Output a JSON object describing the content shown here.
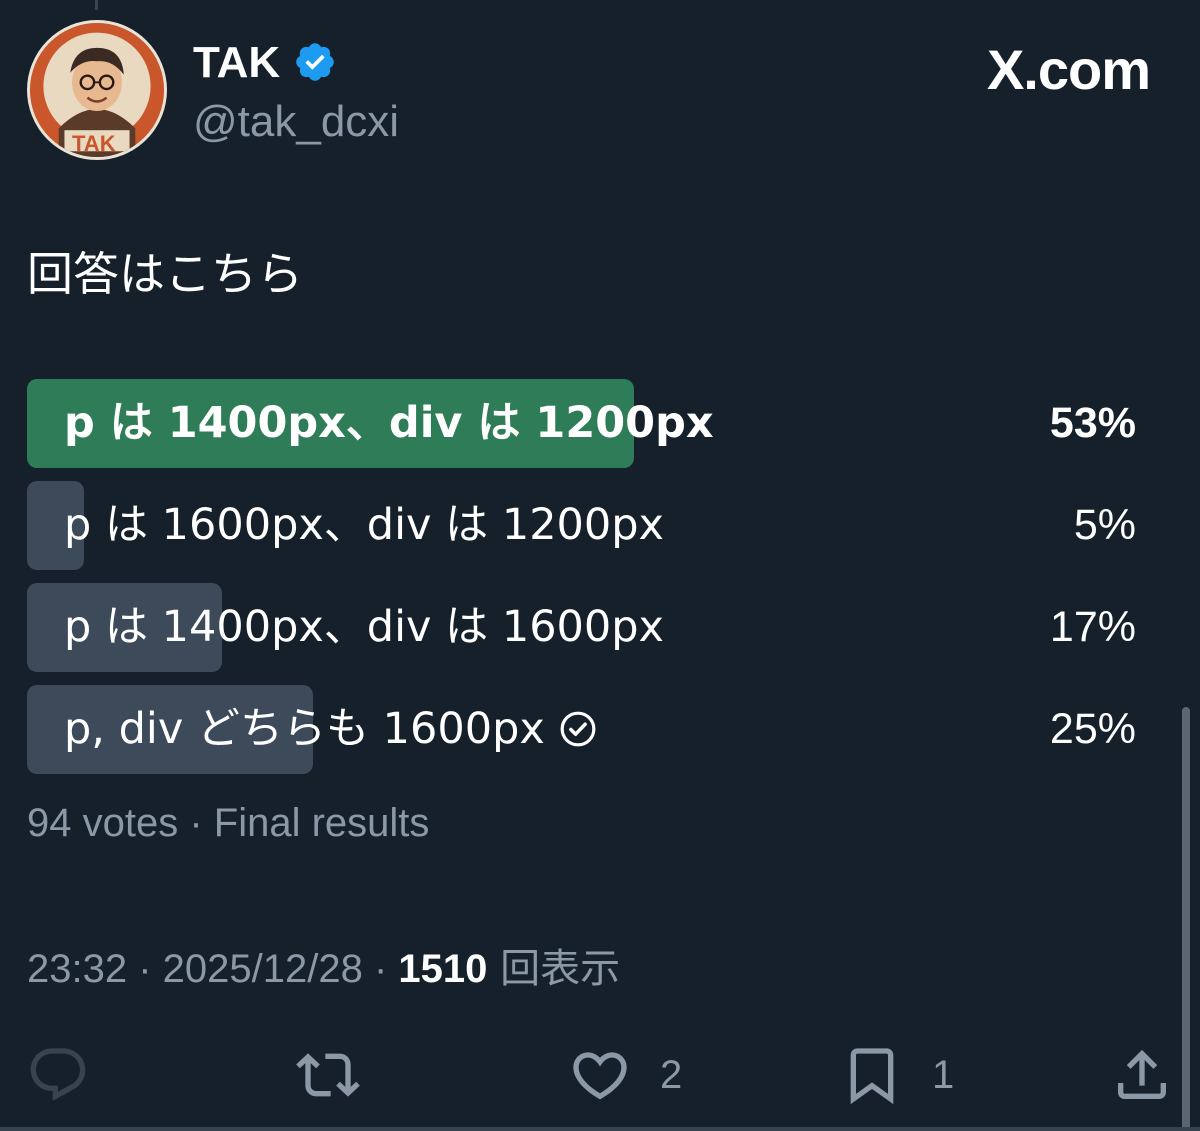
{
  "author": {
    "name": "TAK",
    "handle": "@tak_dcxi",
    "avatar_text": "TAK",
    "verified": true
  },
  "brand": "X.com",
  "tweet": {
    "text": "回答はこちら"
  },
  "poll": {
    "options": [
      {
        "label": "p は 1400px、div は 1200px",
        "percent_text": "53%",
        "percent": 53,
        "winner": true,
        "selected": false
      },
      {
        "label": "p は 1600px、div は 1200px",
        "percent_text": "5%",
        "percent": 5,
        "winner": false,
        "selected": false
      },
      {
        "label": "p は 1400px、div は 1600px",
        "percent_text": "17%",
        "percent": 17,
        "winner": false,
        "selected": false
      },
      {
        "label": "p, div どちらも 1600px",
        "percent_text": "25%",
        "percent": 25,
        "winner": false,
        "selected": true
      }
    ],
    "meta": "94 votes · Final results"
  },
  "timestamp": {
    "time_date": "23:32 · 2025/12/28 · ",
    "views_count": "1510",
    "views_label": " 回表示"
  },
  "actions": {
    "reply": {
      "icon": "reply-icon",
      "count": ""
    },
    "repost": {
      "icon": "repost-icon",
      "count": ""
    },
    "like": {
      "icon": "heart-icon",
      "count": "2"
    },
    "bookmark": {
      "icon": "bookmark-icon",
      "count": "1"
    },
    "share": {
      "icon": "share-icon",
      "count": ""
    }
  },
  "colors": {
    "background": "#15202b",
    "winner_bar": "#2f7d58",
    "bar": "#3c4a5a",
    "verified": "#1d9bf0",
    "muted_text": "#8b98a5"
  }
}
